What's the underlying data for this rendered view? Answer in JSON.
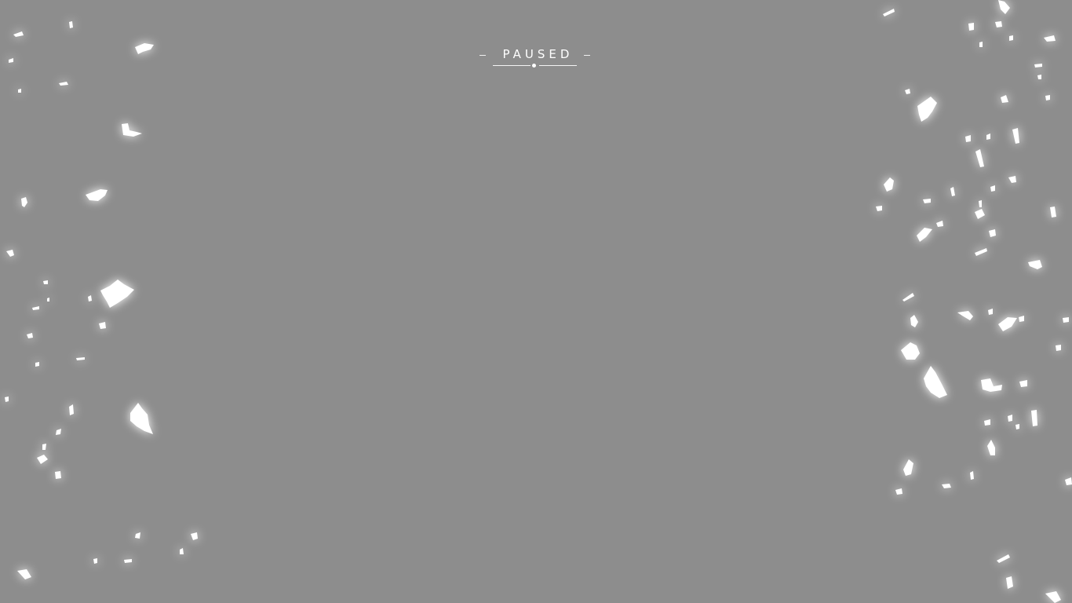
{
  "pause_menu": {
    "title": "PAUSED"
  },
  "colors": {
    "background": "#8d8d8d",
    "text": "#ffffff",
    "particles": "#ffffff"
  }
}
